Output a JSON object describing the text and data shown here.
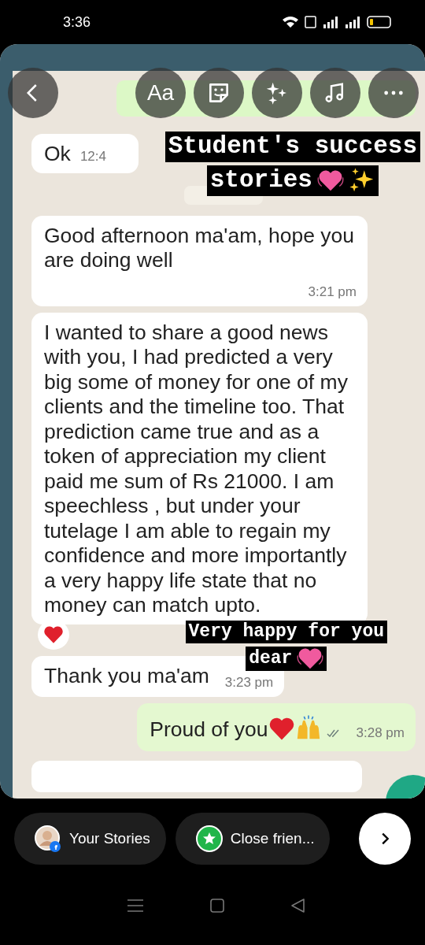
{
  "status_bar": {
    "time": "3:36"
  },
  "editor_tools": [
    {
      "kind": "back"
    },
    {
      "kind": "text",
      "label": "Aa"
    },
    {
      "kind": "sticker"
    },
    {
      "kind": "effects"
    },
    {
      "kind": "music"
    },
    {
      "kind": "more"
    }
  ],
  "chat": {
    "messages": [
      {
        "kind": "incoming",
        "text": "Ok",
        "time": "12:4",
        "ticks": false,
        "reacted": false
      },
      {
        "kind": "incoming",
        "text": "Good afternoon ma'am, hope you are doing well",
        "time": "3:21 pm",
        "ticks": false,
        "reacted": false
      },
      {
        "kind": "incoming",
        "text": "I wanted to share a good news with you, I had predicted a very big some of money for one of my clients and the timeline too. That prediction came true and as a token of appreciation my client paid me sum of Rs 21000. I am speechless , but under your tutelage I am able to regain my confidence and more importantly a very happy life state that no money can match upto.",
        "ticks": false,
        "reacted": true
      },
      {
        "kind": "incoming",
        "text": "Thank you ma'am",
        "time": "3:23 pm",
        "ticks": false,
        "reacted": false
      },
      {
        "kind": "outgoing",
        "text": "Proud of you",
        "time": "3:28 pm",
        "ticks": true,
        "reacted": false,
        "emoji": [
          {
            "kind": "heart"
          },
          {
            "kind": "raised-hands"
          }
        ]
      }
    ]
  },
  "captions": [
    {
      "lines": [
        "Student's success",
        "stories"
      ],
      "emoji": [
        {
          "kind": "beating-heart"
        },
        {
          "kind": "sparkles"
        }
      ]
    },
    {
      "lines": [
        "Very happy for you",
        "dear"
      ],
      "emoji": [
        {
          "kind": "beating-heart"
        }
      ]
    }
  ],
  "share_bar": {
    "options": [
      {
        "kind": "your-stories",
        "label": "Your Stories"
      },
      {
        "kind": "close-friends",
        "label": "Close frien..."
      }
    ]
  }
}
